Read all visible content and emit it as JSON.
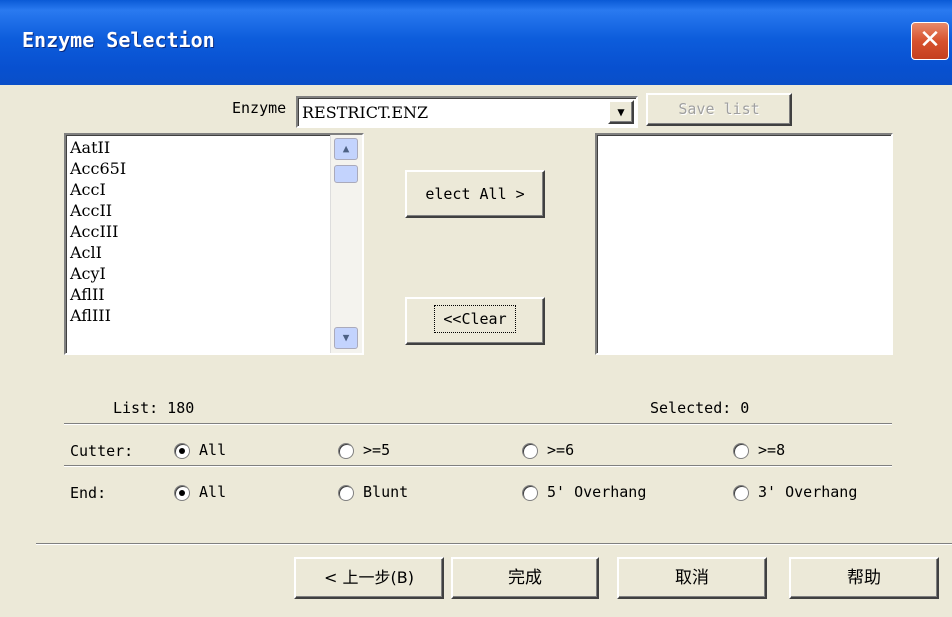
{
  "window": {
    "title": "Enzyme Selection",
    "close_glyph": "✕"
  },
  "enzyme_field": {
    "label": "Enzyme",
    "value": "RESTRICT.ENZ",
    "dropdown_glyph": "▼"
  },
  "save_list_label": "Save list",
  "available_list": {
    "items": [
      "AatII",
      "Acc65I",
      "AccI",
      "AccII",
      "AccIII",
      "AclI",
      "AcyI",
      "AflII",
      "AflIII"
    ],
    "scroll_up_glyph": "▲",
    "scroll_down_glyph": "▼"
  },
  "buttons": {
    "select_all": "elect All >",
    "clear": "<<Clear"
  },
  "counts": {
    "list": "List: 180",
    "selected": "Selected: 0"
  },
  "cutter": {
    "label": "Cutter:",
    "options": [
      {
        "label": "All",
        "checked": true
      },
      {
        "label": ">=5",
        "checked": false
      },
      {
        "label": ">=6",
        "checked": false
      },
      {
        "label": ">=8",
        "checked": false
      }
    ]
  },
  "end": {
    "label": "End:",
    "options": [
      {
        "label": "All",
        "checked": true
      },
      {
        "label": "Blunt",
        "checked": false
      },
      {
        "label": "5' Overhang",
        "checked": false
      },
      {
        "label": "3' Overhang",
        "checked": false
      }
    ]
  },
  "footer": {
    "back": "< 上一步(B)",
    "finish": "完成",
    "cancel": "取消",
    "help": "帮助"
  },
  "colors": {
    "title_bar": "#0a5ad6",
    "face": "#ece9d8",
    "close": "#d7522e"
  },
  "icons": {
    "close": "close-icon",
    "dropdown": "chevron-down-icon",
    "scroll_up": "scroll-up-icon",
    "scroll_down": "scroll-down-icon"
  }
}
